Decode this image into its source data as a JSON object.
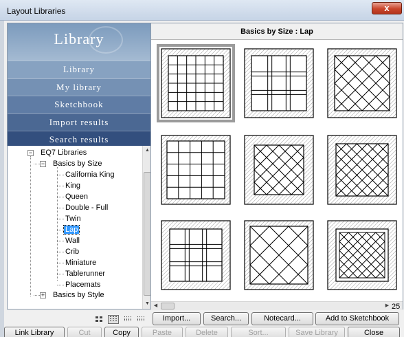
{
  "window": {
    "title": "Layout Libraries",
    "close_label": "x"
  },
  "sidebar": {
    "header": "Library",
    "nav": [
      {
        "label": "Library",
        "color": "#87a2c1"
      },
      {
        "label": "My library",
        "color": "#7591b4"
      },
      {
        "label": "Sketchbook",
        "color": "#5f7ca5"
      },
      {
        "label": "Import results",
        "color": "#4b6893"
      },
      {
        "label": "Search results",
        "color": "#334f7e"
      }
    ],
    "tree": {
      "root": "EQ7 Libraries",
      "group": "Basics by Size",
      "items": [
        "California King",
        "King",
        "Queen",
        "Double - Full",
        "Twin",
        "Lap",
        "Wall",
        "Crib",
        "Miniature",
        "Tablerunner",
        "Placemats"
      ],
      "selected": "Lap",
      "sibling": "Basics by Style"
    }
  },
  "main": {
    "heading": "Basics by Size  :  Lap",
    "count": "25",
    "layouts": [
      {
        "pattern": "straight-grid",
        "selected": true
      },
      {
        "pattern": "sashed-grid"
      },
      {
        "pattern": "on-point"
      },
      {
        "pattern": "straight-grid-wide"
      },
      {
        "pattern": "on-point-small"
      },
      {
        "pattern": "on-point-dense"
      },
      {
        "pattern": "sashed-grid-3x3"
      },
      {
        "pattern": "on-point-large"
      },
      {
        "pattern": "on-point-inner-border"
      }
    ]
  },
  "toolbar": {
    "import": "Import...",
    "search": "Search...",
    "notecard": "Notecard...",
    "add_sketchbook": "Add to Sketchbook"
  },
  "bottom": {
    "link_library": "Link Library",
    "cut": "Cut",
    "copy": "Copy",
    "paste": "Paste",
    "delete": "Delete",
    "sort": "Sort...",
    "save_library": "Save Library",
    "close": "Close"
  }
}
